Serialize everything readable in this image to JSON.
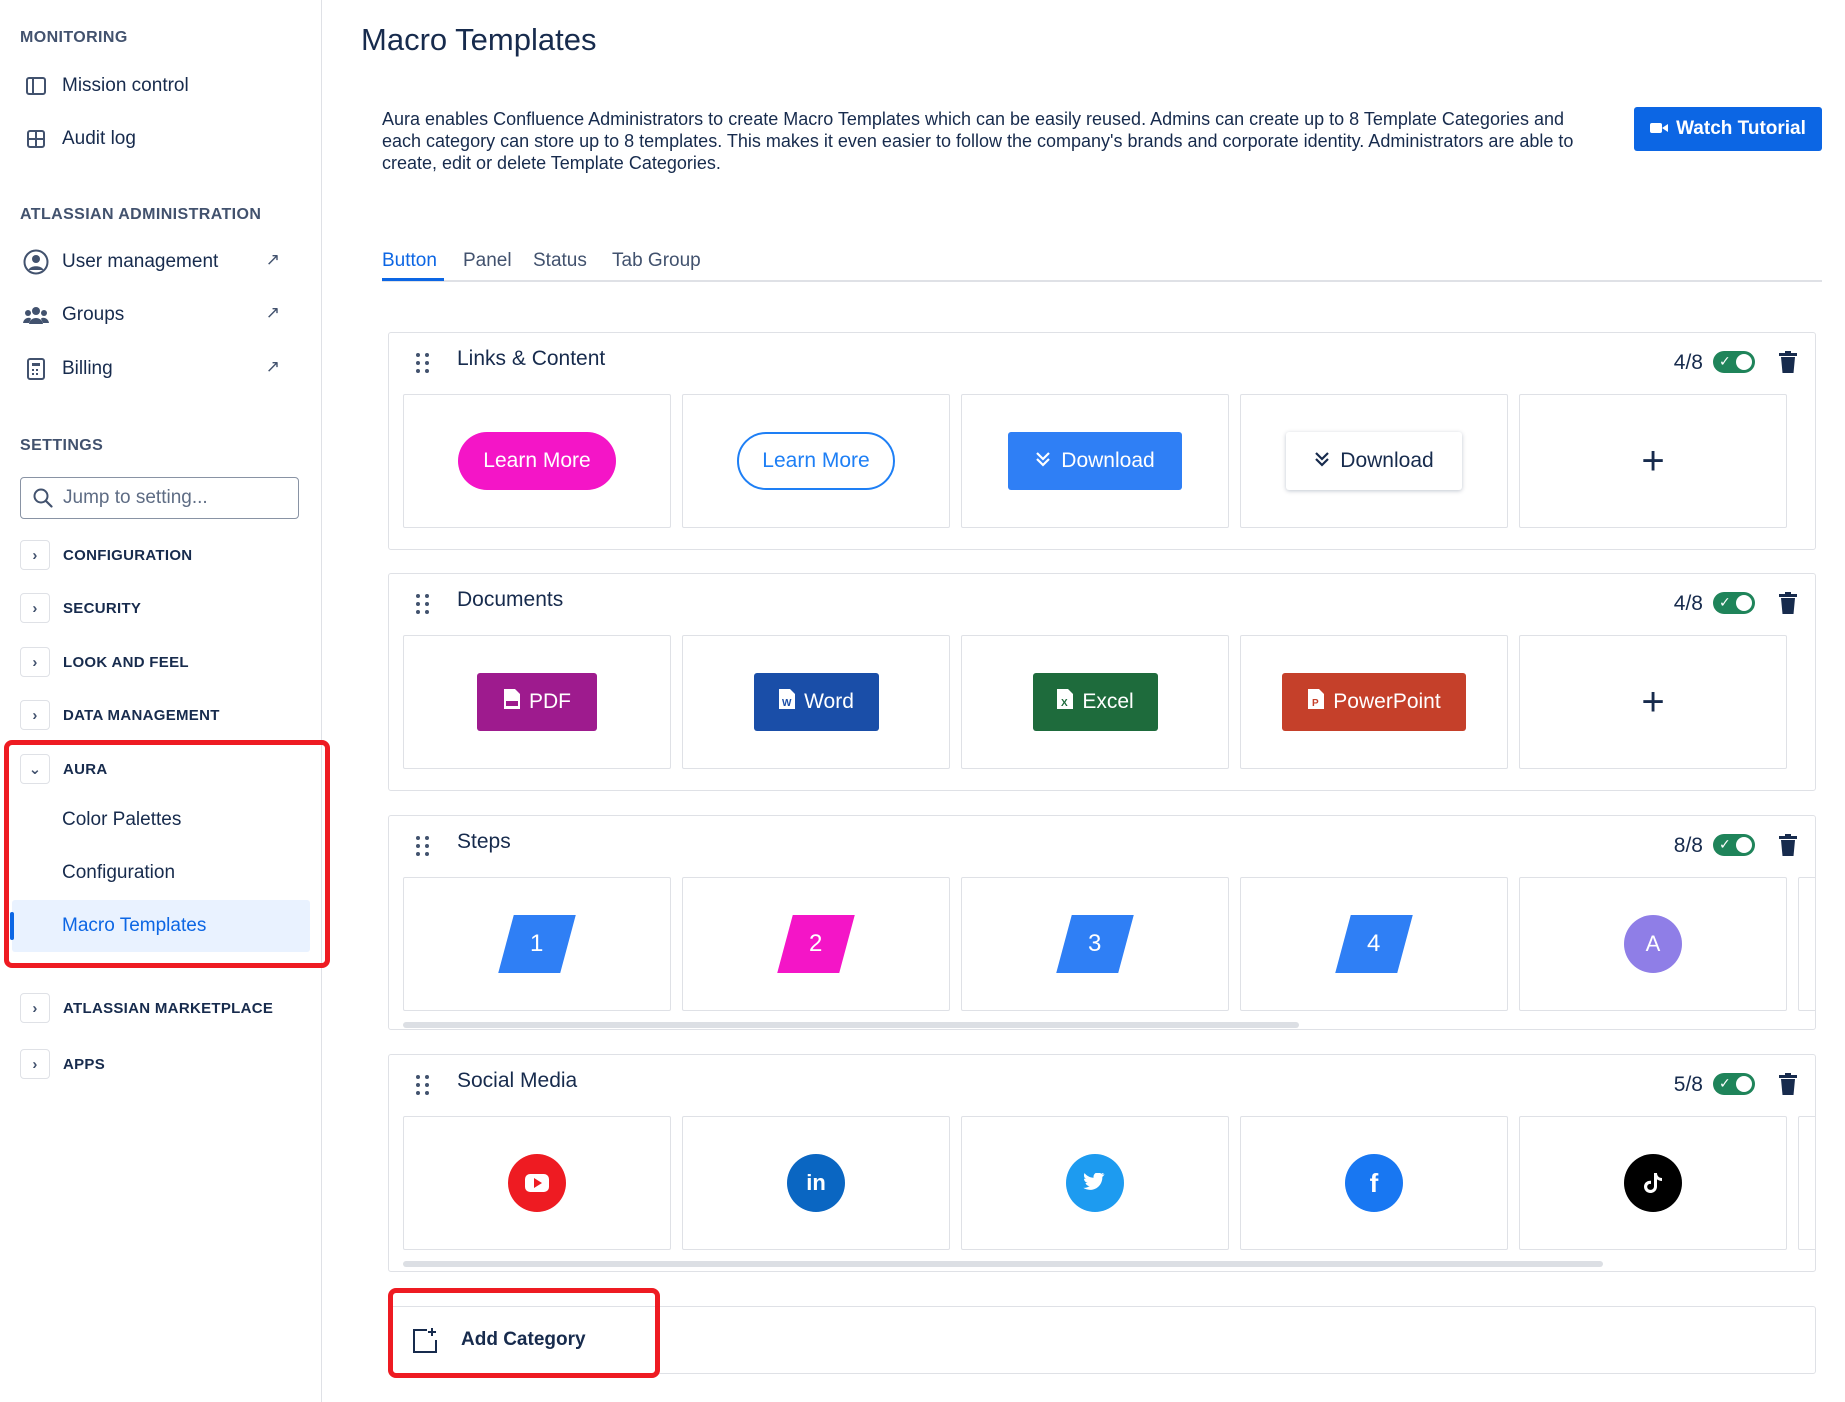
{
  "sidebar": {
    "monitoring_heading": "MONITORING",
    "mission_control": "Mission control",
    "audit_log": "Audit log",
    "atlassian_admin_heading": "ATLASSIAN ADMINISTRATION",
    "user_management": "User management",
    "groups": "Groups",
    "billing": "Billing",
    "external_arrow": "↗",
    "settings_heading": "SETTINGS",
    "search_placeholder": "Jump to setting...",
    "collapsibles": {
      "configuration": "CONFIGURATION",
      "security": "SECURITY",
      "look_and_feel": "LOOK AND FEEL",
      "data_management": "DATA MANAGEMENT",
      "aura": "AURA",
      "atlassian_marketplace": "ATLASSIAN MARKETPLACE",
      "apps": "APPS"
    },
    "aura_items": {
      "color_palettes": "Color Palettes",
      "configuration": "Configuration",
      "macro_templates": "Macro Templates"
    },
    "chevron_right": "›",
    "chevron_down": "⌄"
  },
  "main": {
    "title": "Macro Templates",
    "description": "Aura enables Confluence Administrators to create Macro Templates which can be easily reused. Admins can create up to 8 Template Categories and each category can store up to 8 templates. This makes it even easier to follow the company's brands and corporate identity. Administrators are able to create, edit or delete Template Categories.",
    "watch_tutorial": "Watch Tutorial",
    "tabs": [
      "Button",
      "Panel",
      "Status",
      "Tab Group"
    ],
    "active_tab": "Button"
  },
  "categories": [
    {
      "title": "Links & Content",
      "count": "4/8",
      "enabled": true,
      "tiles": [
        "Learn More",
        "Learn More",
        "Download",
        "Download",
        "+"
      ]
    },
    {
      "title": "Documents",
      "count": "4/8",
      "enabled": true,
      "tiles": [
        "PDF",
        "Word",
        "Excel",
        "PowerPoint",
        "+"
      ]
    },
    {
      "title": "Steps",
      "count": "8/8",
      "enabled": true,
      "tiles": [
        "1",
        "2",
        "3",
        "4",
        "A"
      ]
    },
    {
      "title": "Social Media",
      "count": "5/8",
      "enabled": true,
      "tiles": [
        "youtube-icon",
        "linkedin-icon",
        "twitter-icon",
        "facebook-icon",
        "tiktok-icon"
      ],
      "linkedin_text": "in",
      "facebook_text": "f"
    }
  ],
  "add_category": "Add Category",
  "toggle_check": "✓",
  "colors": {
    "primary": "#0c66e4",
    "pink": "#f415c7",
    "pdf": "#9e1b8e",
    "word": "#1a4ea8",
    "excel": "#1e6b3c",
    "powerpoint": "#c5402a",
    "highlight": "#ee1b22",
    "toggle_on": "#1f845a"
  }
}
